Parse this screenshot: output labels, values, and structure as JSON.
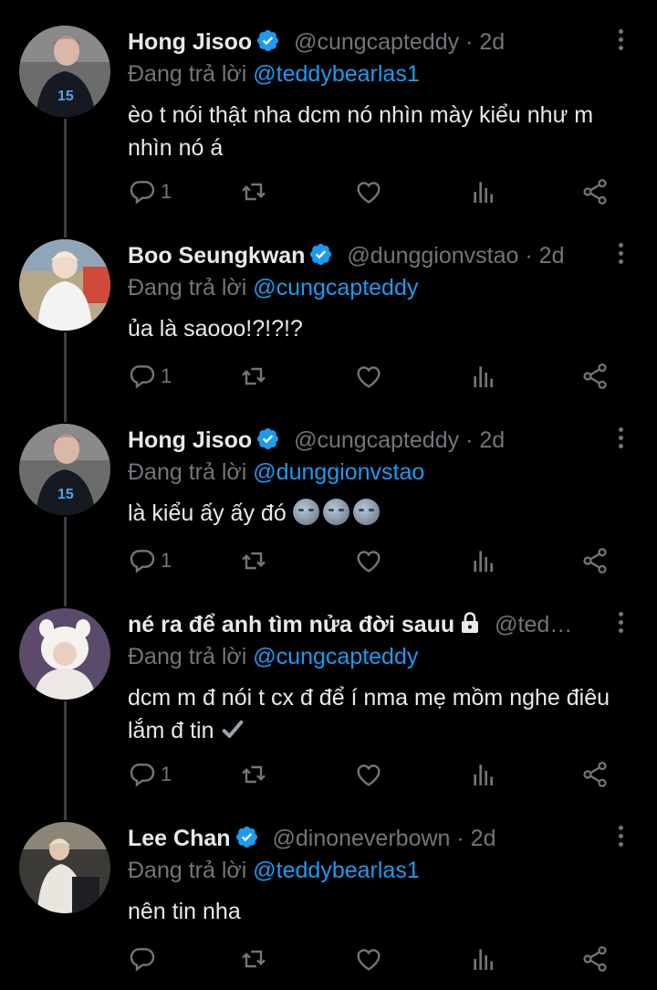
{
  "tweets": [
    {
      "name": "Hong Jisoo",
      "verified": true,
      "handle": "@cungcapteddy",
      "dot": "·",
      "time": "2d",
      "replying_prefix": "Đang trả lời",
      "replying_to": "@teddybearlas1",
      "text": "èo t nói thật nha dcm nó nhìn mày kiểu như m nhìn nó á",
      "reply_count": "1"
    },
    {
      "name": "Boo Seungkwan",
      "verified": true,
      "handle": "@dunggionvstao",
      "dot": "·",
      "time": "2d",
      "replying_prefix": "Đang trả lời",
      "replying_to": "@cungcapteddy",
      "text": "ủa là saooo!?!?!?",
      "reply_count": "1"
    },
    {
      "name": "Hong Jisoo",
      "verified": true,
      "handle": "@cungcapteddy",
      "dot": "·",
      "time": "2d",
      "replying_prefix": "Đang trả lời",
      "replying_to": "@dunggionvstao",
      "text": "là kiểu ấy ấy đó",
      "emoji": [
        "new-moon-face",
        "new-moon-face",
        "new-moon-face"
      ],
      "reply_count": "1"
    },
    {
      "name": "né ra để anh tìm nửa đời sauu",
      "verified": false,
      "locked": true,
      "handle": "@ted…",
      "replying_prefix": "Đang trả lời",
      "replying_to": "@cungcapteddy",
      "text": "dcm m đ nói t cx đ để í nma mẹ mồm nghe điêu lắm đ tin",
      "emoji": [
        "heavy-check-mark"
      ],
      "reply_count": "1"
    },
    {
      "name": "Lee Chan",
      "verified": true,
      "handle": "@dinoneverbown",
      "dot": "·",
      "time": "2d",
      "replying_prefix": "Đang trả lời",
      "replying_to": "@teddybearlas1",
      "text": "nên tin nha",
      "reply_count": ""
    }
  ],
  "icons": {
    "reply": "reply-icon",
    "retweet": "retweet-icon",
    "like": "heart-icon",
    "views": "analytics-icon",
    "share": "share-icon",
    "more": "more-vertical-icon",
    "verified": "verified-badge-icon",
    "lock": "lock-icon"
  },
  "colors": {
    "background": "#000000",
    "text": "#e7e9ea",
    "muted": "#71767b",
    "accent": "#1d9bf0"
  }
}
